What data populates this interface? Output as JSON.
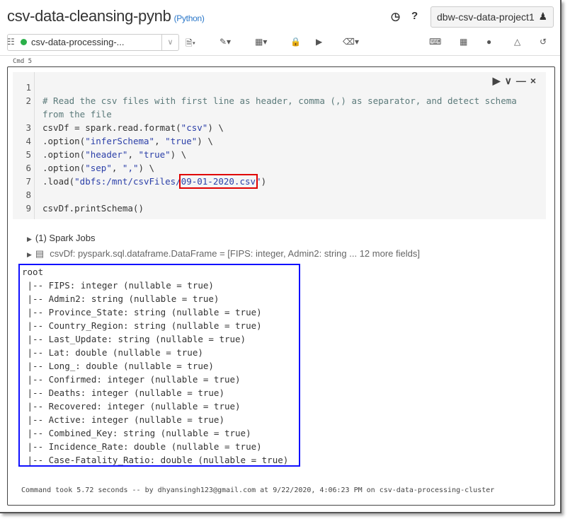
{
  "header": {
    "title": "csv-data-cleansing-pynb",
    "language": "(Python)",
    "workspace": "dbw-csv-data-project1"
  },
  "toolbar": {
    "cluster": "csv-data-processing-..."
  },
  "cell": {
    "label": "Cmd 5",
    "code": [
      {
        "n": "1",
        "parts": []
      },
      {
        "n": "2",
        "parts": [
          {
            "t": "# Read the csv files with first line as header, comma (,) as separator, and detect schema",
            "c": "cm"
          }
        ]
      },
      {
        "n": "",
        "parts": [
          {
            "t": "from the file",
            "c": "cm"
          }
        ]
      },
      {
        "n": "3",
        "parts": [
          {
            "t": "csvDf = spark.read.format(",
            "c": ""
          },
          {
            "t": "\"csv\"",
            "c": "st"
          },
          {
            "t": ") \\",
            "c": ""
          }
        ]
      },
      {
        "n": "4",
        "parts": [
          {
            "t": ".option(",
            "c": ""
          },
          {
            "t": "\"inferSchema\"",
            "c": "st"
          },
          {
            "t": ", ",
            "c": ""
          },
          {
            "t": "\"true\"",
            "c": "st"
          },
          {
            "t": ") \\",
            "c": ""
          }
        ]
      },
      {
        "n": "5",
        "parts": [
          {
            "t": ".option(",
            "c": ""
          },
          {
            "t": "\"header\"",
            "c": "st"
          },
          {
            "t": ", ",
            "c": ""
          },
          {
            "t": "\"true\"",
            "c": "st"
          },
          {
            "t": ") \\",
            "c": ""
          }
        ]
      },
      {
        "n": "6",
        "parts": [
          {
            "t": ".option(",
            "c": ""
          },
          {
            "t": "\"sep\"",
            "c": "st"
          },
          {
            "t": ", ",
            "c": ""
          },
          {
            "t": "\",\"",
            "c": "st"
          },
          {
            "t": ") \\",
            "c": ""
          }
        ]
      },
      {
        "n": "7",
        "parts": [
          {
            "t": ".load(",
            "c": ""
          },
          {
            "t": "\"dbfs:/mnt/csvFiles/",
            "c": "st"
          },
          {
            "t": "09-01-2020.csv",
            "c": "st hl"
          },
          {
            "t": "\"",
            "c": "st"
          },
          {
            "t": ")",
            "c": ""
          }
        ]
      },
      {
        "n": "8",
        "parts": []
      },
      {
        "n": "9",
        "parts": [
          {
            "t": "csvDf.printSchema()",
            "c": ""
          }
        ]
      }
    ]
  },
  "output": {
    "spark_jobs": "(1) Spark Jobs",
    "dataframe": "csvDf:  pyspark.sql.dataframe.DataFrame = [FIPS: integer, Admin2: string ... 12 more fields]",
    "schema": [
      "root",
      " |-- FIPS: integer (nullable = true)",
      " |-- Admin2: string (nullable = true)",
      " |-- Province_State: string (nullable = true)",
      " |-- Country_Region: string (nullable = true)",
      " |-- Last_Update: string (nullable = true)",
      " |-- Lat: double (nullable = true)",
      " |-- Long_: double (nullable = true)",
      " |-- Confirmed: integer (nullable = true)",
      " |-- Deaths: integer (nullable = true)",
      " |-- Recovered: integer (nullable = true)",
      " |-- Active: integer (nullable = true)",
      " |-- Combined_Key: string (nullable = true)",
      " |-- Incidence_Rate: double (nullable = true)",
      " |-- Case-Fatality_Ratio: double (nullable = true)"
    ],
    "footer": "Command took 5.72 seconds -- by dhyansingh123@gmail.com at 9/22/2020, 4:06:23 PM on csv-data-processing-cluster"
  }
}
